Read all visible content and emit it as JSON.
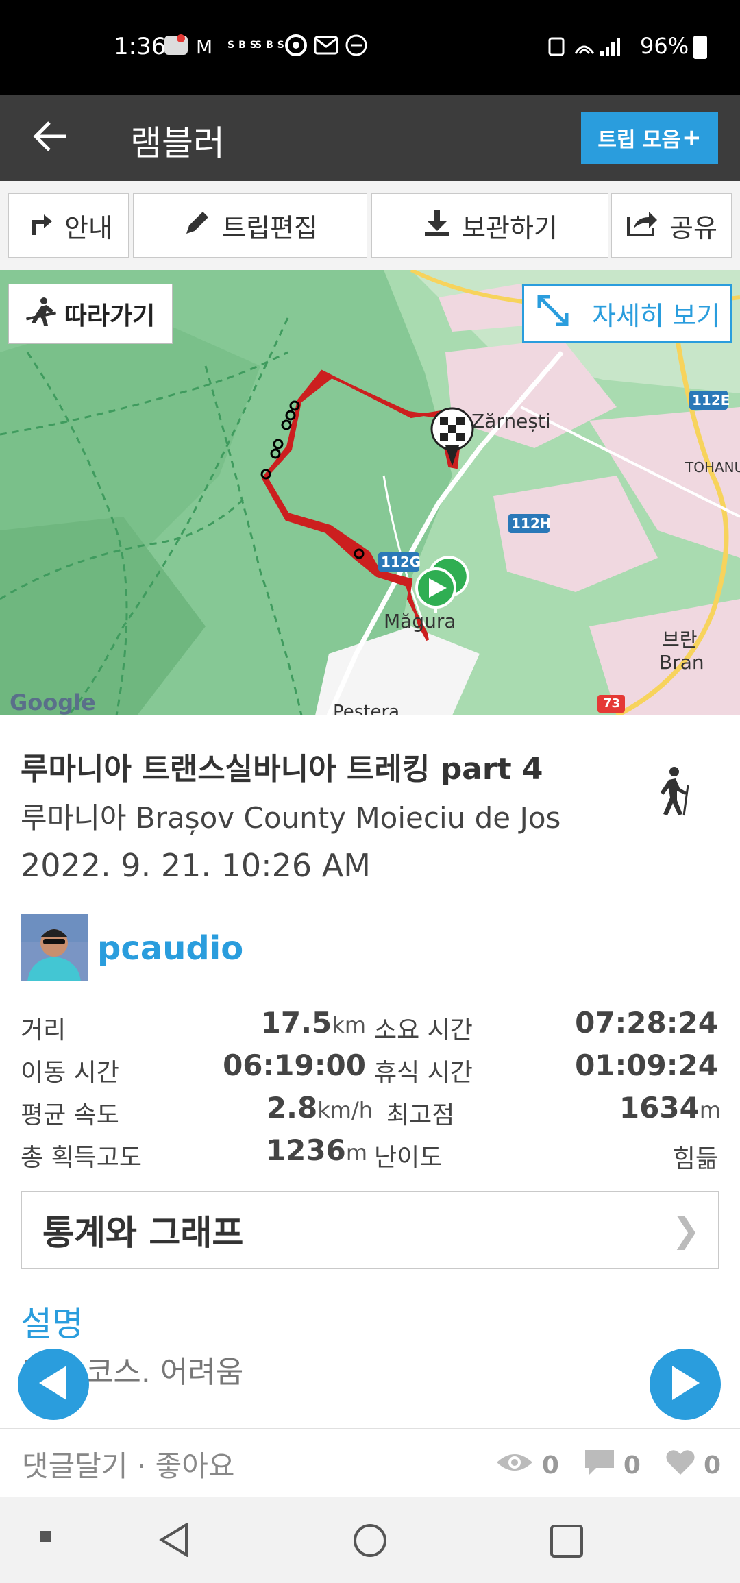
{
  "status_bar": {
    "time": "1:36",
    "notification_icons": "",
    "battery": "96%"
  },
  "app_bar": {
    "title": "램블러",
    "trip_collection_label": "트립 모음",
    "trip_collection_plus": "+"
  },
  "toolbar": {
    "guide_label": "안내",
    "edit_label": "트립편집",
    "save_label": "보관하기",
    "share_label": "공유"
  },
  "map": {
    "follow_label": "따라가기",
    "detail_label": "자세히 보기",
    "labels": {
      "zarnesti": "Zărnești",
      "magura": "Măgura",
      "bran_kr": "브란",
      "bran": "Bran",
      "tohanu": "TOHANU",
      "pestera": "Peștera",
      "road_112e": "112E",
      "road_112h": "112H",
      "road_112g": "112G",
      "road_73": "73",
      "google": "Google"
    }
  },
  "trip": {
    "title_kr": "루마니아 트랜스실바니아 트레킹 ",
    "title_part": "part 4",
    "location": "루마니아 Brașov County Moieciu de Jos",
    "date": "2022. 9. 21. 10:26 AM",
    "activity_icon": "hiking-icon"
  },
  "user": {
    "name": "pcaudio"
  },
  "stats": {
    "distance_label": "거리",
    "distance_value": "17.5",
    "distance_unit": "km",
    "duration_label": "소요 시간",
    "duration_value": "07:28:24",
    "moving_label": "이동 시간",
    "moving_value": "06:19:00",
    "rest_label": "휴식 시간",
    "rest_value": "01:09:24",
    "speed_label": "평균 속도",
    "speed_value": "2.8",
    "speed_unit": "km/h",
    "max_elev_label": "최고점",
    "max_elev_value": "1634",
    "max_elev_unit": "m",
    "gain_label": "총 획득고도",
    "gain_value": "1236",
    "gain_unit": "m",
    "difficulty_label": "난이도",
    "difficulty_value": "힘듦"
  },
  "stats_graph_label": "통계와 그래프",
  "stats_graph_chevron": "❯",
  "description": {
    "heading": "설명",
    "text": "모니 코스. 어려움"
  },
  "footer": {
    "comment_like": "댓글달기 · 좋아요",
    "views": "0",
    "comments": "0",
    "likes": "0"
  },
  "colors": {
    "accent": "#2a9ddd",
    "appbar": "#3c3c3c",
    "route": "#cc1f1f",
    "map_green": "#8fcf9c"
  }
}
